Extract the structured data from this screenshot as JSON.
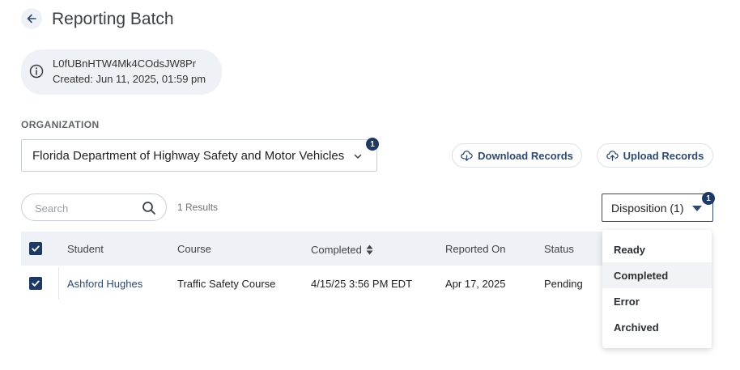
{
  "header": {
    "title": "Reporting Batch"
  },
  "batch": {
    "id": "L0fUBnHTW4Mk4COdsJW8Pr",
    "created": "Created: Jun 11, 2025, 01:59 pm"
  },
  "organization": {
    "label": "ORGANIZATION",
    "selected": "Florida Department of Highway Safety and Motor Vehicles",
    "badge_count": "1"
  },
  "actions": {
    "download_label": "Download Records",
    "upload_label": "Upload Records"
  },
  "search": {
    "placeholder": "Search",
    "value": "",
    "results_text": "1 Results"
  },
  "disposition": {
    "label": "Disposition (1)",
    "badge_count": "1",
    "options": [
      "Ready",
      "Completed",
      "Error",
      "Archived"
    ],
    "highlighted": "Completed"
  },
  "table": {
    "columns": [
      "Student",
      "Course",
      "Completed",
      "Reported On",
      "Status"
    ],
    "rows": [
      {
        "student": "Ashford Hughes",
        "course": "Traffic Safety Course",
        "completed": "4/15/25 3:56 PM EDT",
        "reported_on": "Apr 17, 2025",
        "status": "Pending",
        "checked": true
      }
    ]
  },
  "colors": {
    "primary": "#1e3a64",
    "accent_text": "#2f4a6d",
    "surface": "#eef1f5"
  }
}
